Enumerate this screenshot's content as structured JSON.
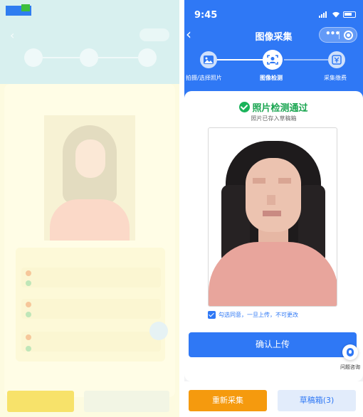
{
  "status_bar": {
    "time": "9:45"
  },
  "nav": {
    "title": "图像采集",
    "more_label": "•••"
  },
  "steps": [
    {
      "label": "拍摄/选择照片",
      "icon": "image-icon"
    },
    {
      "label": "图像检测",
      "icon": "face-scan-icon"
    },
    {
      "label": "采集缴费",
      "icon": "payment-icon"
    }
  ],
  "result": {
    "title": "照片检测通过",
    "subtitle": "照片已存入草稿箱"
  },
  "agreement": {
    "text": "勾选同意，一旦上传，不可更改",
    "checked": true
  },
  "buttons": {
    "confirm": "确认上传",
    "recapture": "重新采集",
    "draft": "草稿箱(3)"
  },
  "help": {
    "label": "问题咨询"
  },
  "colors": {
    "primary": "#2f78f5",
    "success": "#19a550",
    "warning": "#f59a0e"
  }
}
